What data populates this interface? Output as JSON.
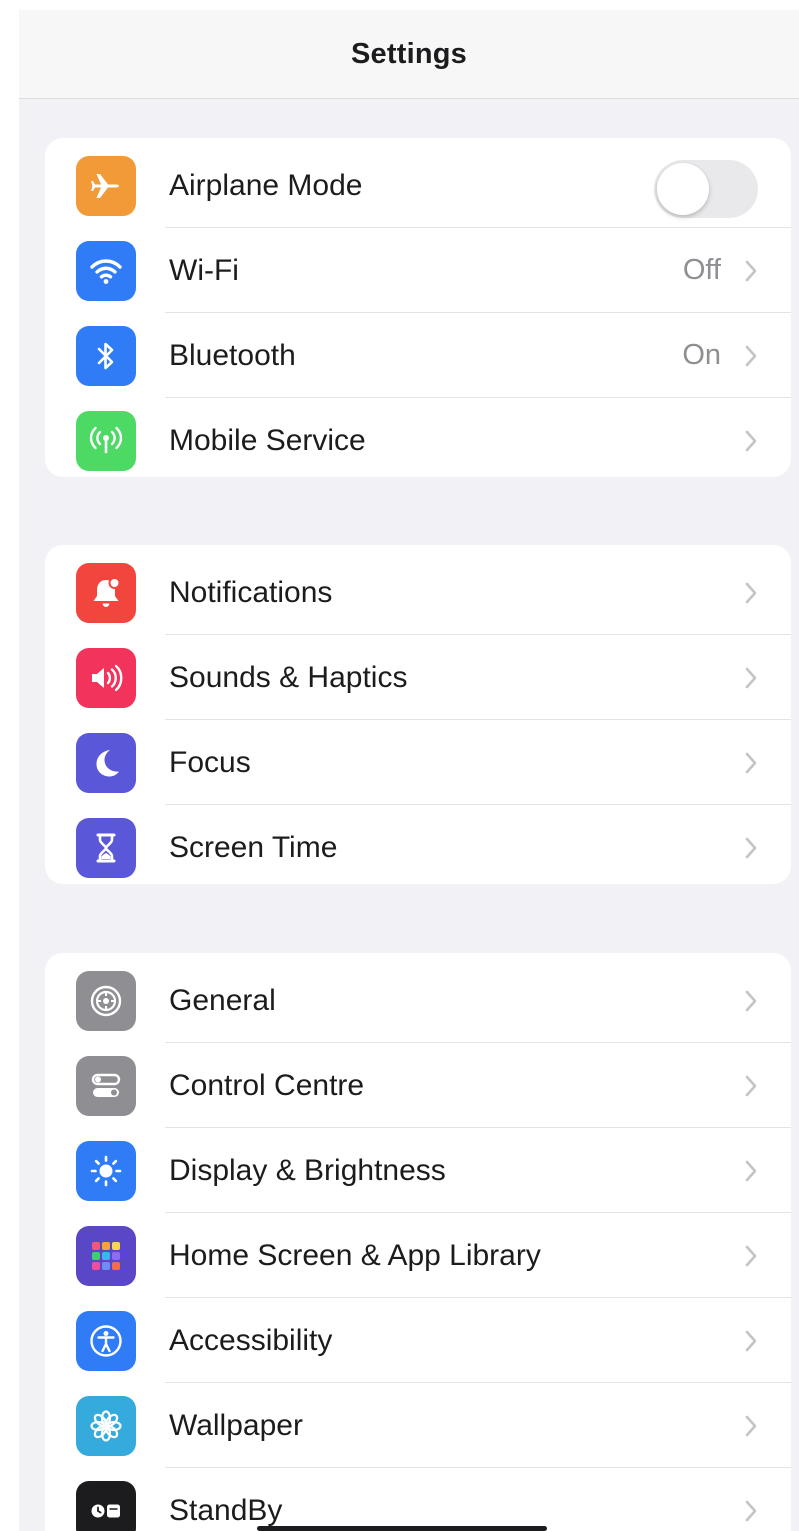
{
  "header": {
    "title": "Settings"
  },
  "groups": [
    {
      "rows": [
        {
          "label": "Airplane Mode",
          "icon": "airplane-icon",
          "icon_color": "#f19a37",
          "toggle_on": false
        },
        {
          "label": "Wi-Fi",
          "icon": "wifi-icon",
          "icon_color": "#2f7cf6",
          "value": "Off"
        },
        {
          "label": "Bluetooth",
          "icon": "bluetooth-icon",
          "icon_color": "#2f7cf6",
          "value": "On"
        },
        {
          "label": "Mobile Service",
          "icon": "antenna-icon",
          "icon_color": "#4cd964"
        }
      ]
    },
    {
      "rows": [
        {
          "label": "Notifications",
          "icon": "bell-icon",
          "icon_color": "#f1453d"
        },
        {
          "label": "Sounds & Haptics",
          "icon": "speaker-icon",
          "icon_color": "#f2335b"
        },
        {
          "label": "Focus",
          "icon": "moon-icon",
          "icon_color": "#5b57d9"
        },
        {
          "label": "Screen Time",
          "icon": "hourglass-icon",
          "icon_color": "#5b57d9"
        }
      ]
    },
    {
      "rows": [
        {
          "label": "General",
          "icon": "gear-icon",
          "icon_color": "#8e8e93"
        },
        {
          "label": "Control Centre",
          "icon": "switches-icon",
          "icon_color": "#8e8e93"
        },
        {
          "label": "Display & Brightness",
          "icon": "sun-icon",
          "icon_color": "#2f7cf6"
        },
        {
          "label": "Home Screen & App Library",
          "icon": "app-grid-icon",
          "icon_color": "#5a47c8"
        },
        {
          "label": "Accessibility",
          "icon": "accessibility-icon",
          "icon_color": "#2f7cf6"
        },
        {
          "label": "Wallpaper",
          "icon": "flower-icon",
          "icon_color": "#35aadc"
        },
        {
          "label": "StandBy",
          "icon": "standby-icon",
          "icon_color": "#1c1c1e"
        }
      ]
    }
  ],
  "colors": {
    "background": "#f2f2f6",
    "separator": "#e4e4e8",
    "secondary_text": "#8e8e93"
  }
}
